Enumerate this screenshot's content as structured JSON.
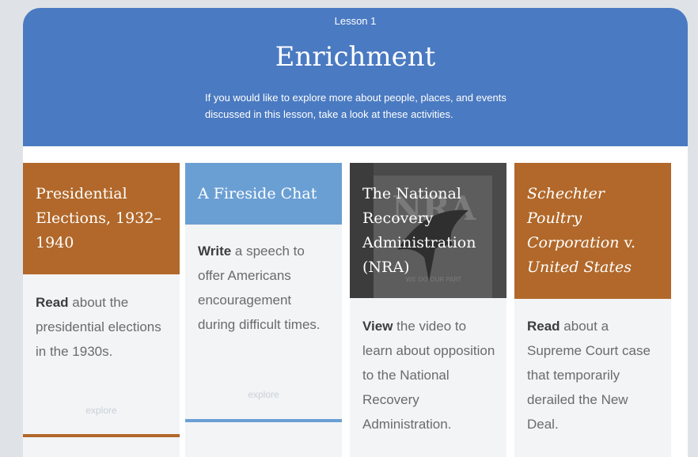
{
  "header": {
    "lesson": "Lesson 1",
    "title": "Enrichment",
    "description": "If you would like to explore more about people, places, and events discussed in this lesson, take a look at these activities."
  },
  "cards": [
    {
      "title": "Presidential Elections, 1932–1940",
      "verb": "Read",
      "body": " about the presidential elections in the 1930s.",
      "link": "explore",
      "color": "#b1682a"
    },
    {
      "title": "A Fireside Chat",
      "verb": "Write",
      "body": " a speech to offer Americans encouragement during difficult times.",
      "link": "explore",
      "color": "#6a9fd4"
    },
    {
      "title": "The National Recovery Administration (NRA)",
      "verb": "View",
      "body": " the video to learn about opposition to the National Recovery Administration.",
      "image_text": [
        "NRA",
        "WE DO OUR PART"
      ],
      "color": "#4b4b4b"
    },
    {
      "title_part1": "Schechter Poultry Corporation",
      "title_part2": " v. ",
      "title_part3": "United States",
      "verb": "Read",
      "body": " about a Supreme Court case that temporarily derailed the New Deal.",
      "color": "#b1682a"
    }
  ]
}
